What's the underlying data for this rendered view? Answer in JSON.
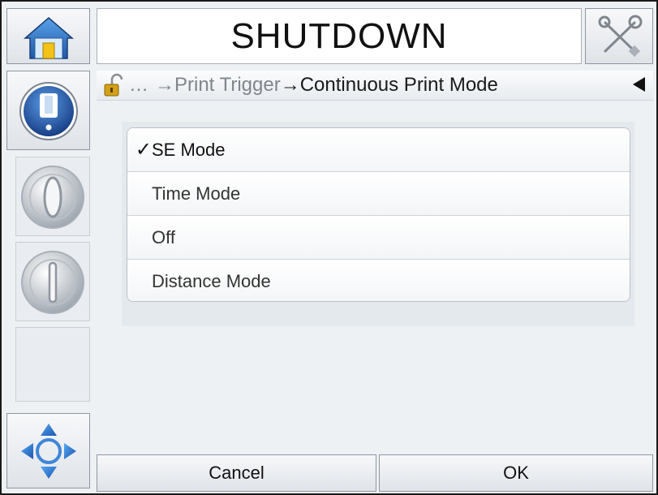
{
  "header": {
    "title": "SHUTDOWN",
    "home_icon": "home-icon",
    "tools_icon": "tools-icon"
  },
  "sidebar": {
    "items": [
      {
        "icon": "ink-bottle-icon",
        "state": "selected"
      },
      {
        "icon": "jet-start-icon"
      },
      {
        "icon": "jet-stop-icon"
      },
      {
        "icon": "navigation-arrows-icon"
      }
    ]
  },
  "breadcrumb": {
    "lock_icon": "unlocked-padlock-icon",
    "ellipsis": "…",
    "parent": "→Print Trigger",
    "current": "→Continuous Print Mode",
    "back_icon": "back-triangle-icon"
  },
  "options": {
    "items": [
      {
        "label": "SE Mode",
        "selected": true,
        "check": "✓"
      },
      {
        "label": "Time Mode",
        "selected": false,
        "check": ""
      },
      {
        "label": "Off",
        "selected": false,
        "check": ""
      },
      {
        "label": "Distance Mode",
        "selected": false,
        "check": ""
      }
    ]
  },
  "footer": {
    "cancel_label": "Cancel",
    "ok_label": "OK"
  },
  "colors": {
    "background": "#eef1f4",
    "accent_blue": "#2b63b8",
    "border": "#8e96a0"
  }
}
